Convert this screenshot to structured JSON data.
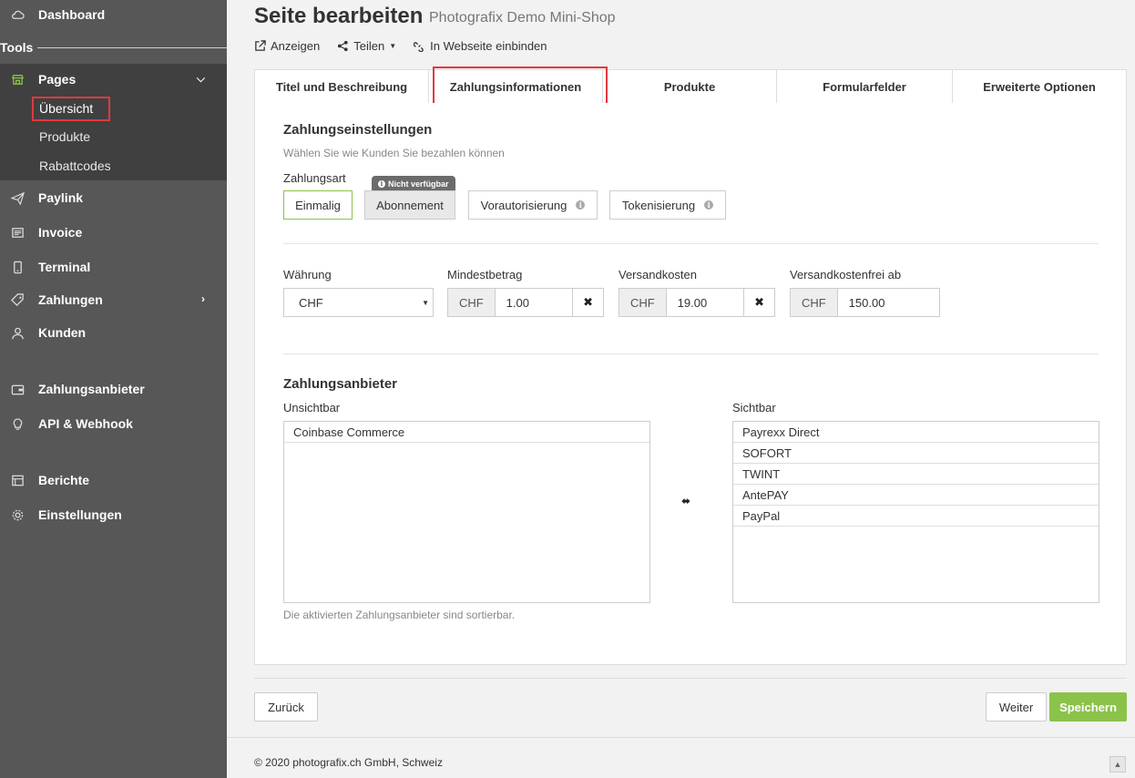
{
  "sidebar": {
    "dashboard": "Dashboard",
    "tools": "Tools",
    "pages": "Pages",
    "sub": [
      "Übersicht",
      "Produkte",
      "Rabattcodes"
    ],
    "items": [
      "Paylink",
      "Invoice",
      "Terminal",
      "Zahlungen",
      "Kunden",
      "Zahlungsanbieter",
      "API & Webhook",
      "Berichte",
      "Einstellungen"
    ]
  },
  "header": {
    "title": "Seite bearbeiten",
    "subtitle": "Photografix Demo Mini-Shop",
    "actions": [
      "Anzeigen",
      "Teilen",
      "In Webseite einbinden"
    ]
  },
  "tabs": [
    "Titel und Beschreibung",
    "Zahlungsinformationen",
    "Produkte",
    "Formularfelder",
    "Erweiterte Optionen"
  ],
  "payment_settings": {
    "heading": "Zahlungseinstellungen",
    "hint": "Wählen Sie wie Kunden Sie bezahlen können",
    "type_label": "Zahlungsart",
    "badge": "Nicht verfügbar",
    "types": [
      "Einmalig",
      "Abonnement",
      "Vorautorisierung",
      "Tokenisierung"
    ]
  },
  "amounts": {
    "currency_label": "Währung",
    "currency_value": "CHF",
    "min_label": "Mindestbetrag",
    "min_addon": "CHF",
    "min_value": "1.00",
    "ship_label": "Versandkosten",
    "ship_addon": "CHF",
    "ship_value": "19.00",
    "free_label": "Versandkostenfrei ab",
    "free_addon": "CHF",
    "free_value": "150.00"
  },
  "providers": {
    "heading": "Zahlungsanbieter",
    "invisible_label": "Unsichtbar",
    "invisible": [
      "Coinbase Commerce"
    ],
    "visible_label": "Sichtbar",
    "visible": [
      "Payrexx Direct",
      "SOFORT",
      "TWINT",
      "AntePAY",
      "PayPal"
    ],
    "hint": "Die aktivierten Zahlungsanbieter sind sortierbar."
  },
  "footer_buttons": {
    "back": "Zurück",
    "next": "Weiter",
    "save": "Speichern"
  },
  "footer": {
    "copyright": "© 2020 photografix.ch GmbH, Schweiz"
  },
  "colors": {
    "sidebar": "#575757",
    "sidebar_active": "#404040",
    "accent": "#8bc34a",
    "highlight": "#e0393e"
  }
}
